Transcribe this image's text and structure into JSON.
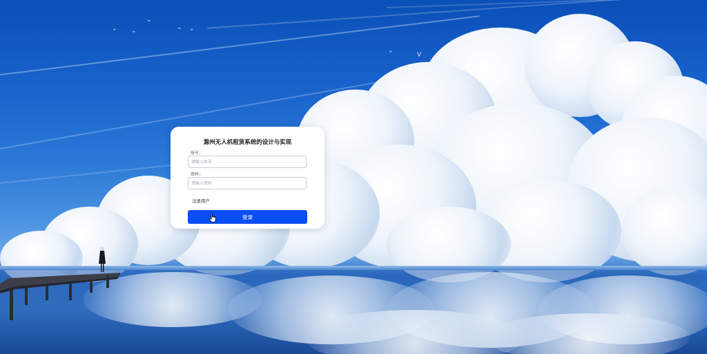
{
  "login": {
    "title": "滁州无人机租赁系统的设计与实现",
    "account_label": "账号：",
    "account_placeholder": "请输入账号",
    "account_value": "",
    "password_label": "密码：",
    "password_placeholder": "请输入密码",
    "password_value": "",
    "register_link": "注册用户",
    "submit_label": "登录"
  },
  "colors": {
    "primary_button": "#0b4ef5",
    "card_background": "#ffffff",
    "sky": "#1863cc"
  },
  "icons": {
    "cursor": "hand-pointer-icon"
  }
}
